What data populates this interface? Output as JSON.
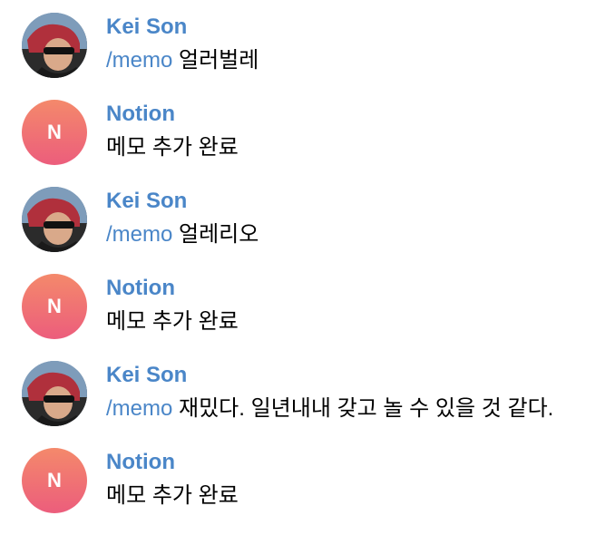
{
  "colors": {
    "name": "#4a86c8",
    "command": "#4a86c8",
    "text": "#000000",
    "avatar_gradient_top": "#f4896b",
    "avatar_gradient_bottom": "#ec5d7c"
  },
  "messages": [
    {
      "sender": "Kei Son",
      "avatar": "user-photo",
      "command": "/memo",
      "text": " 얼러벌레"
    },
    {
      "sender": "Notion",
      "avatar": "N",
      "text": "메모 추가 완료"
    },
    {
      "sender": "Kei Son",
      "avatar": "user-photo",
      "command": "/memo",
      "text": " 얼레리오"
    },
    {
      "sender": "Notion",
      "avatar": "N",
      "text": "메모 추가 완료"
    },
    {
      "sender": "Kei Son",
      "avatar": "user-photo",
      "command": "/memo",
      "text": " 재밌다. 일년내내 갖고 놀 수 있을 것 같다."
    },
    {
      "sender": "Notion",
      "avatar": "N",
      "text": "메모 추가 완료"
    }
  ]
}
